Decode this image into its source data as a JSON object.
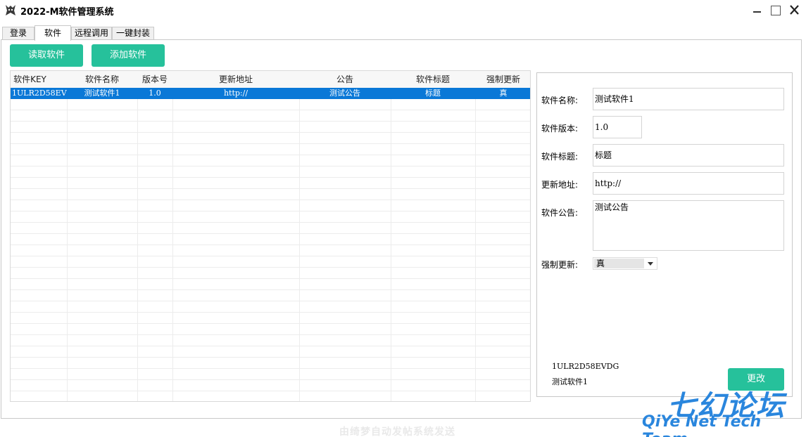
{
  "window": {
    "title": "2022-M软件管理系统"
  },
  "tabs": [
    {
      "label": "登录"
    },
    {
      "label": "软件"
    },
    {
      "label": "远程调用"
    },
    {
      "label": "一键封装"
    }
  ],
  "toolbar": {
    "read_label": "读取软件",
    "add_label": "添加软件"
  },
  "table": {
    "headers": [
      "软件KEY",
      "软件名称",
      "版本号",
      "更新地址",
      "公告",
      "软件标题",
      "强制更新"
    ],
    "rows": [
      [
        "1ULR2D58EVDG",
        "测试软件1",
        "1.0",
        "http://",
        "测试公告",
        "标题",
        "真"
      ]
    ]
  },
  "detail": {
    "name_label": "软件名称:",
    "name_value": "测试软件1",
    "version_label": "软件版本:",
    "version_value": "1.0",
    "title_label": "软件标题:",
    "title_value": "标题",
    "url_label": "更新地址:",
    "url_value": "http://",
    "notice_label": "软件公告:",
    "notice_value": "测试公告",
    "force_label": "强制更新:",
    "force_value": "真",
    "info_key": "1ULR2D58EVDG",
    "info_name": "测试软件1",
    "change_label": "更改"
  },
  "footer": {
    "text": "由绮梦自动发帖系统发送"
  },
  "watermark": {
    "cn": "七幻论坛",
    "en": "QiYe Net Tech Team"
  },
  "colors": {
    "accent_green": "#26c19b",
    "selection_blue": "#0a78d7",
    "watermark_blue": "#2a86dd"
  }
}
